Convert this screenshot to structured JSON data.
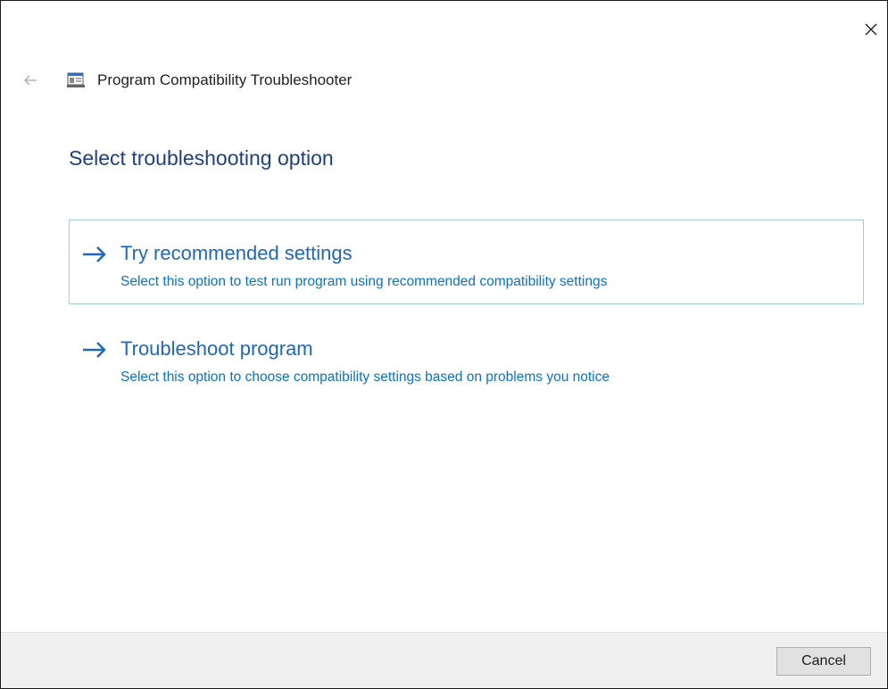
{
  "window": {
    "title": "Program Compatibility Troubleshooter",
    "close_icon": "close-icon",
    "back_icon": "back-arrow-icon",
    "app_icon": "program-compatibility-icon"
  },
  "page": {
    "title": "Select troubleshooting option"
  },
  "options": [
    {
      "title": "Try recommended settings",
      "description": "Select this option to test run program using recommended compatibility settings",
      "icon": "arrow-right-icon",
      "selected": true
    },
    {
      "title": "Troubleshoot program",
      "description": "Select this option to choose compatibility settings based on problems you notice",
      "icon": "arrow-right-icon",
      "selected": false
    }
  ],
  "footer": {
    "cancel_label": "Cancel"
  },
  "colors": {
    "accent": "#1f67b8",
    "link": "#0a73c4",
    "heading": "#1e3f86",
    "selection_border": "#9fcbe4",
    "footer_bg": "#f0f0f0"
  }
}
